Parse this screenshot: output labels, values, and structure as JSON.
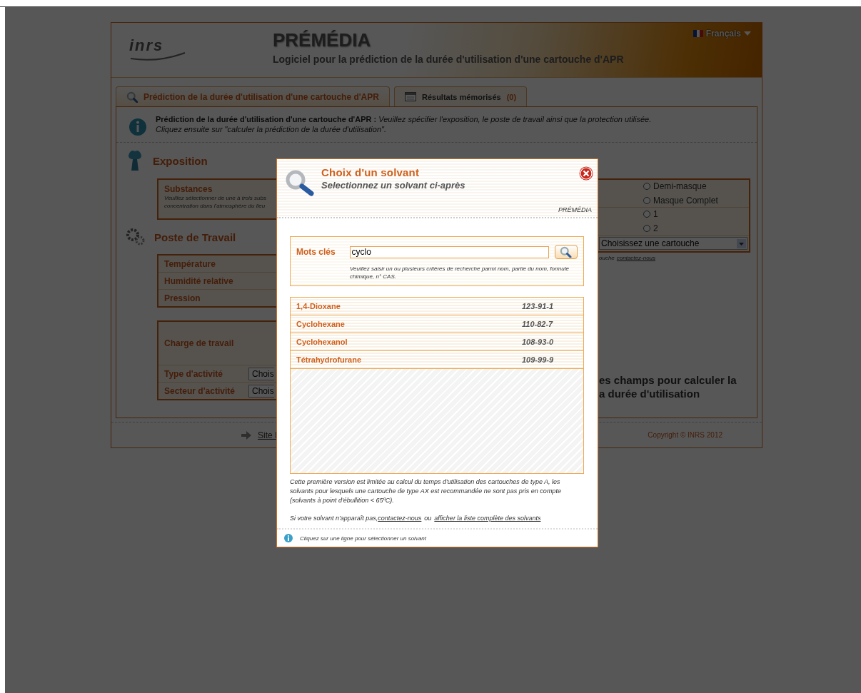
{
  "header": {
    "logo": "inrs",
    "title": "PRÉMÉDIA",
    "subtitle": "Logiciel pour la prédiction de la durée d'utilisation d'une cartouche d'APR",
    "language": "Français"
  },
  "tabs": [
    {
      "label": "Prédiction de la durée d'utilisation d'une cartouche d'APR",
      "selected": true
    },
    {
      "label": "Résultats mémorisés",
      "count": "(0)",
      "selected": false
    }
  ],
  "intro": {
    "lines": [
      "**Prédiction de la durée d'utilisation d'une cartouche d'APR :** *Veuillez spécifier l'exposition, le poste de travail ainsi que la protection utilisée.*",
      "*Cliquez ensuite sur \"calculer la prédiction de la durée d'utilisation\".*"
    ]
  },
  "exposition": {
    "title": "Exposition",
    "substances": {
      "label": "Substances",
      "hint_lines": [
        "Veuillez sélectionner de une à trois subs",
        "concentration dans l'atmosphère du lieu"
      ]
    }
  },
  "protection": {
    "options": [
      {
        "label": "Demi-masque",
        "selected": false
      },
      {
        "label": "Masque Complet",
        "selected": false
      },
      {
        "label": "1",
        "selected": false
      },
      {
        "label": "2",
        "selected": false
      }
    ],
    "cartridge_select": "Choisissez une cartouche",
    "note": "ouche",
    "note_link": "contactez-nous"
  },
  "workstation": {
    "title": "Poste de Travail",
    "rows": [
      "Température",
      "Humidité relative",
      "Pression"
    ]
  },
  "workload": {
    "rows": [
      {
        "label": "Charge de travail",
        "kind": "plain"
      },
      {
        "label": "Type d'activité",
        "kind": "select",
        "value": "Chois"
      },
      {
        "label": "Secteur d'activité",
        "kind": "select",
        "value": "Chois"
      }
    ]
  },
  "prompt_lines": [
    "es champs pour calculer la",
    "a durée d'utilisation"
  ],
  "footer": {
    "link": "Site I",
    "copyright": "Copyright © INRS 2012"
  },
  "dialog": {
    "title": "Choix d'un solvant",
    "subtitle": "Selectionnez un solvant ci-après",
    "brand": "PRÉMÉDIA",
    "search": {
      "label": "Mots clés",
      "value": "cyclo",
      "hint": "Veuillez saisir un ou plusieurs critères de recherche parmi nom, partie du nom, formule chimique, n° CAS."
    },
    "results": [
      {
        "name": "1,4-Dioxane",
        "cas": "123-91-1"
      },
      {
        "name": "Cyclohexane",
        "cas": "110-82-7"
      },
      {
        "name": "Cyclohexanol",
        "cas": "108-93-0"
      },
      {
        "name": "Tétrahydrofurane",
        "cas": "109-99-9"
      }
    ],
    "note": "Cette première version est limitée au calcul du temps d'utilisation des cartouches de type A, les solvants pour lesquels une cartouche de type AX est recommandée ne sont pas pris en compte (solvants à point d'ébullition < 65ºC).",
    "missing": {
      "text": "Si votre solvant n'apparaît pas,",
      "link1": "contactez-nous",
      "between": "ou",
      "link2": "afficher la liste complète des solvants"
    },
    "footer": "Cliquez sur une ligne pour sélectionner un solvant"
  }
}
